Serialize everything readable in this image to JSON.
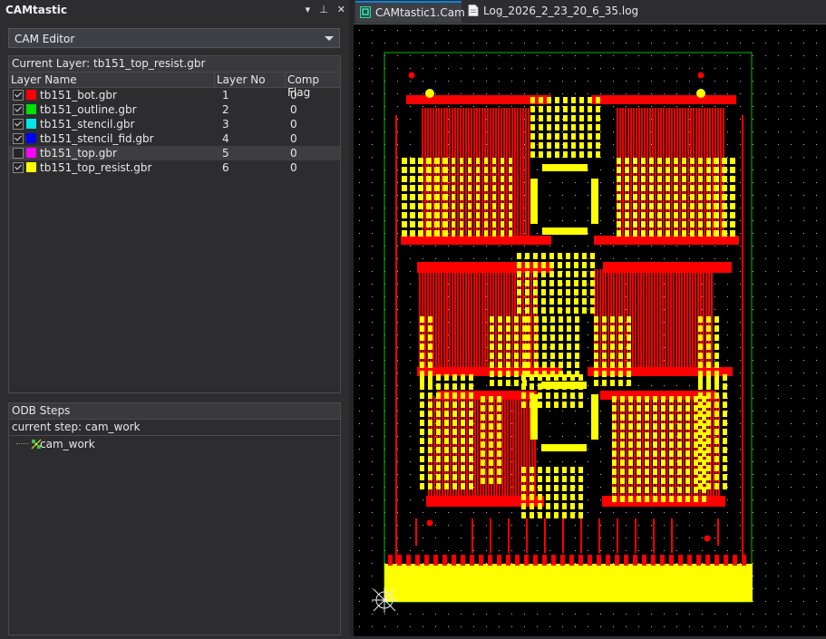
{
  "panel": {
    "title": "CAMtastic",
    "editor_select": "CAM Editor",
    "current_layer": "Current Layer: tb151_top_resist.gbr",
    "columns": [
      "Layer Name",
      "Layer No",
      "Comp Flag"
    ],
    "layers": [
      {
        "name": "tb151_bot.gbr",
        "no": "1",
        "flag": "0",
        "color": "#ff0000",
        "checked": true
      },
      {
        "name": "tb151_outline.gbr",
        "no": "2",
        "flag": "0",
        "color": "#00e000",
        "checked": true
      },
      {
        "name": "tb151_stencil.gbr",
        "no": "3",
        "flag": "0",
        "color": "#00e5e5",
        "checked": true
      },
      {
        "name": "tb151_stencil_fid.gbr",
        "no": "4",
        "flag": "0",
        "color": "#0000ff",
        "checked": true
      },
      {
        "name": "tb151_top.gbr",
        "no": "5",
        "flag": "0",
        "color": "#ff00ff",
        "checked": false
      },
      {
        "name": "tb151_top_resist.gbr",
        "no": "6",
        "flag": "0",
        "color": "#ffff00",
        "checked": true
      }
    ],
    "odb_title": "ODB Steps",
    "current_step": "current step: cam_work",
    "step_item": "cam_work"
  },
  "tabs": [
    {
      "label": "CAMtastic1.Cam *",
      "active": true,
      "icon": "cam-file-icon"
    },
    {
      "label": "Log_2026_2_23_20_6_35.log",
      "active": false,
      "icon": "log-file-icon"
    }
  ],
  "colors": {
    "red": "#ff0000",
    "yellow": "#ffff00",
    "outline": "#00c000"
  }
}
